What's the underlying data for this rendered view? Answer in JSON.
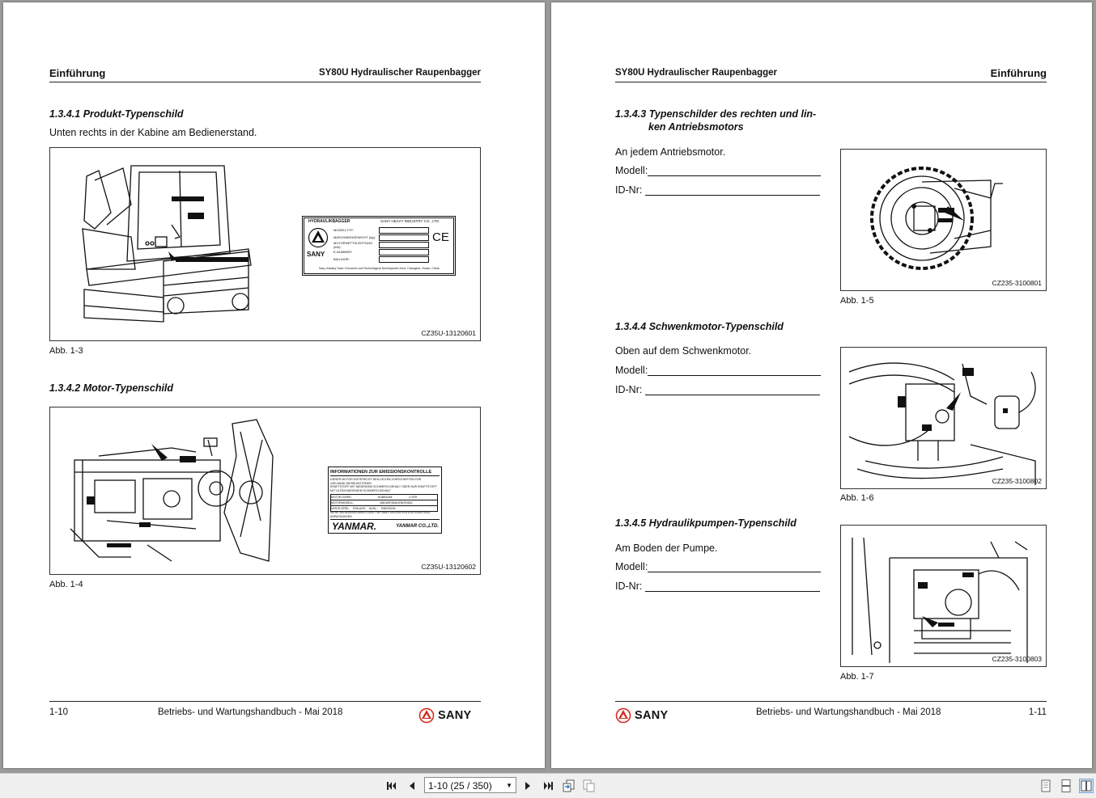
{
  "left_page": {
    "header_left": "Einführung",
    "header_right": "SY80U Hydraulischer Raupenbagger",
    "s1_title": "1.3.4.1  Produkt-Typenschild",
    "s1_text": "Unten rechts in der Kabine am Bedienerstand.",
    "fig1_code": "CZ35U-13120601",
    "fig1_caption": "Abb. 1-3",
    "plate1": {
      "title": "HYDRAULIKBAGGER",
      "company": "SANY HEAVY INDUSTRY CO., LTD",
      "rows": [
        "MODELLTYP:",
        "MASCHINENGEWICHT (kg):",
        "MOTORNETTOLEISTUNG (kW):",
        "E-NUMMER:",
        "BAUJAHR:"
      ],
      "footer": "Sany Industry Town, Economic and Technological Development Zone, Changsha, Hunan, China",
      "logo_text": "SANY",
      "ce": "CE"
    },
    "s2_title": "1.3.4.2 Motor-Typenschild",
    "fig2_code": "CZ35U-13120602",
    "fig2_caption": "Abb. 1-4",
    "plate2": {
      "title": "INFORMATIONEN ZUR EMISSIONSKONTROLLE",
      "lines": [
        "DIESER MOTOR ENTSPRICHT DEN US-EPA-VORSCHRIFTEN FÜR",
        "•GELÄNDE-DIESELMOTOREN",
        "KRAFTSTOFF MIT NIEDRIGEM SCHWEFELGEHALT ODER NUR KRAFTSTOFF",
        "MIT ULTRA NIEDRIGEM SCHWEFELGEHALT"
      ],
      "row1": [
        "MOTOR-SERIE:",
        "HUBRAUM:",
        "LITER"
      ],
      "row2": [
        "MOTORMODELL:",
        "ABGASFAMILIENKENNZ.:"
      ],
      "row3": [
        "VENTILSPIEL:",
        "EINLASS:",
        "AUSL.:",
        "EMISSION:"
      ],
      "note": "SIEHE BEDIENUNGSANLEITUNG FÜR WARTUNGSSPEZIFIKATIONEN UND -ANPASSUNGEN",
      "brand": "YANMAR.",
      "company": "YANMAR CO.,LTD."
    },
    "footer_page": "1-10",
    "footer_center": "Betriebs- und Wartungshandbuch - Mai 2018",
    "footer_logo": "SANY"
  },
  "right_page": {
    "header_left": "SY80U Hydraulischer Raupenbagger",
    "header_right": "Einführung",
    "s3_title_line1": "1.3.4.3 Typenschilder des rechten und lin-",
    "s3_title_line2": "ken Antriebsmotors",
    "s3_text": "An jedem Antriebsmotor.",
    "s4_title": "1.3.4.4 Schwenkmotor-Typenschild",
    "s4_text": "Oben auf dem Schwenkmotor.",
    "s5_title": "1.3.4.5 Hydraulikpumpen-Typenschild",
    "s5_text": "Am Boden der Pumpe.",
    "label_modell": "Modell:",
    "label_id": "ID-Nr:",
    "fig5_code": "CZ235-3100801",
    "fig5_caption": "Abb. 1-5",
    "fig6_code": "CZ235-3100802",
    "fig6_caption": "Abb. 1-6",
    "fig7_code": "CZ235-3100803",
    "fig7_caption": "Abb. 1-7",
    "footer_logo": "SANY",
    "footer_center": "Betriebs- und Wartungshandbuch - Mai 2018",
    "footer_page": "1-11"
  },
  "toolbar": {
    "page_value": "1-10 (25 / 350)",
    "icons": [
      "first-page-icon",
      "previous-page-icon",
      "next-page-icon",
      "last-page-icon",
      "go-back-view-icon",
      "go-forward-view-icon",
      "single-page-view-icon",
      "continuous-view-icon",
      "two-page-view-icon"
    ]
  },
  "colors": {
    "sany_red": "#d52b1e",
    "toolbar_bg": "#f0f0f0",
    "viewer_bg": "#9a9a9a"
  }
}
